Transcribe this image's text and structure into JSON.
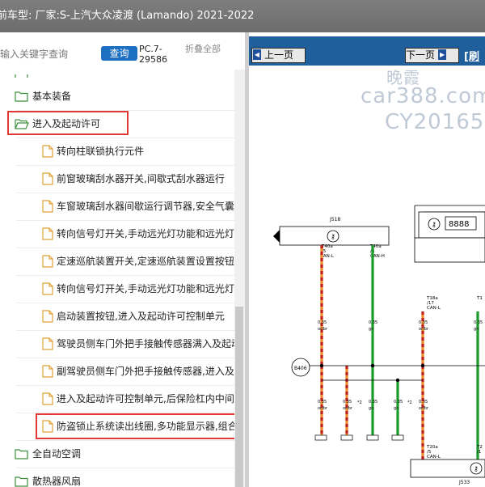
{
  "window": {
    "title": "前车型:  厂家:S-上汽大众凌渡 (Lamando) 2021-2022"
  },
  "search": {
    "placeholder": "输入关键字查询",
    "query_label": "查询",
    "pc_code": "PC.7-29586",
    "collapse_label": "折叠全部"
  },
  "tree": {
    "items": [
      {
        "label": "基本装备"
      },
      {
        "label": "进入及起动许可"
      },
      {
        "label": "转向柱联锁执行元件"
      },
      {
        "label": "前窗玻璃刮水器开关,间歇式刮水器运行"
      },
      {
        "label": "车窗玻璃刮水器间歇运行调节器,安全气囊"
      },
      {
        "label": "转向信号灯开关,手动远光灯功能和远光灯"
      },
      {
        "label": "定速巡航装置开关,定速巡航装置设置按钮"
      },
      {
        "label": "转向信号灯开关,手动远光灯功能和远光灯"
      },
      {
        "label": "启动装置按钮,进入及起动许可控制单元"
      },
      {
        "label": "驾驶员侧车门外把手接触传感器满入及起动"
      },
      {
        "label": "副驾驶员侧车门外把手接触传感器,进入及起动"
      },
      {
        "label": "进入及起动许可控制单元,后保险杠内中间"
      },
      {
        "label": "防盗锁止系统读出线圈,多功能显示器,组合"
      },
      {
        "label": "全自动空调"
      },
      {
        "label": "散热器风扇"
      }
    ]
  },
  "viewer": {
    "prev_label": "上一页",
    "next_label": "下一页",
    "link_label": "[刷",
    "watermark1": "car388.com",
    "watermark2": "CY20165",
    "watermark3": "晚霞"
  },
  "schematic": {
    "j518": "J518",
    "j533": "J533",
    "b406": "B406",
    "t40a_l": "T40a",
    "t40a_l_pin": "/5",
    "t40a_l_sig": "CAN-L",
    "t40a_r": "T40a",
    "t40a_r_pin": "/6",
    "t40a_r_sig": "CAN-H",
    "t18a": "T18a",
    "t18a_pin": "/17",
    "t18a_sig": "CAN-L",
    "t1_right": "T1",
    "w1": "0.35",
    "w1c": "or/br",
    "w2": "0.35",
    "w2c": "gn",
    "w3": "0.35",
    "w3c": "or/br",
    "w4": "0.35",
    "w4c": "gn",
    "w5": "0.35",
    "w5c": "or/br",
    "w6": "0.35",
    "w6c": "or/br",
    "w7": "0.35",
    "w7c": "gn",
    "w8": "0.35",
    "w8c": "gn",
    "w9": "0.35",
    "w9c": "or/br",
    "star2a": "*2",
    "star2b": "*2",
    "t20a": "T20a",
    "t20a_pin": "/5",
    "t20a_sig": "CAN-L",
    "t2_right": "T2",
    "t2_pin": "/1",
    "display_digits": "8888"
  },
  "colors": {
    "accent_blue": "#1d6fc2",
    "navbar": "#1f5f9b",
    "highlight": "#e53935",
    "wire_orange": "#e8892a",
    "wire_green": "#1a9c2a"
  }
}
